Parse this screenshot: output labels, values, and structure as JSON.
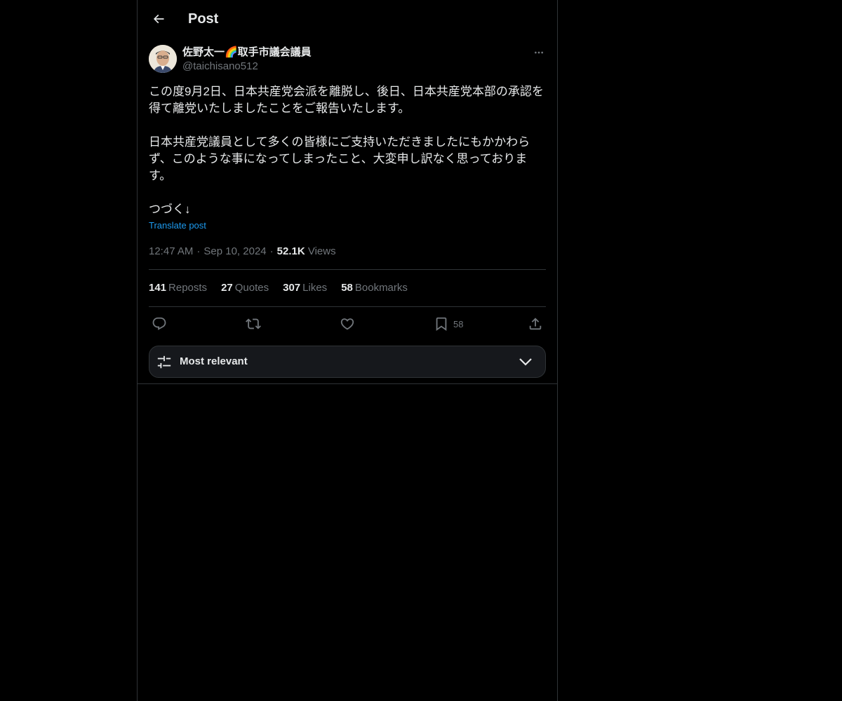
{
  "header": {
    "title": "Post",
    "back_icon": "arrow-left-icon"
  },
  "post": {
    "author": {
      "name": "佐野太一🌈取手市議会議員",
      "handle": "@taichisano512"
    },
    "body": {
      "paragraph1": "この度9月2日、日本共産党会派を離脱し、後日、日本共産党本部の承認を得て離党いたしましたことをご報告いたします。",
      "paragraph2": "日本共産党議員として多くの皆様にご支持いただきましたにもかかわらず、このような事になってしまったこと、大変申し訳なく思っております。",
      "paragraph3": "つづく↓"
    },
    "translate_label": "Translate post",
    "time": "12:47 AM",
    "date": "Sep 10, 2024",
    "views_count": "52.1K",
    "views_label": "Views",
    "stats": {
      "reposts_count": "141",
      "reposts_label": "Reposts",
      "quotes_count": "27",
      "quotes_label": "Quotes",
      "likes_count": "307",
      "likes_label": "Likes",
      "bookmarks_count": "58",
      "bookmarks_label": "Bookmarks"
    },
    "actions": {
      "bookmark_count": "58"
    }
  },
  "sort": {
    "label": "Most relevant"
  },
  "colors": {
    "background": "#000000",
    "text": "#e7e9ea",
    "muted": "#71767b",
    "accent": "#1d9bf0",
    "border": "#2f3336"
  }
}
